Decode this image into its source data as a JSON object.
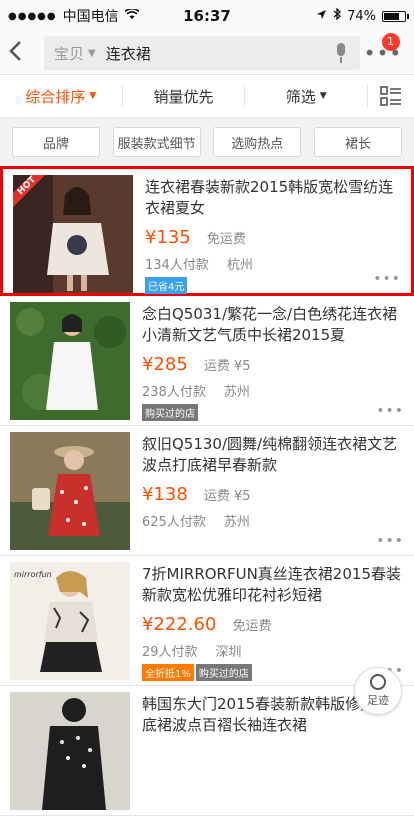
{
  "status": {
    "carrier": "中国电信",
    "time": "16:37",
    "battery": "74%",
    "battery_level": 0.74
  },
  "search": {
    "scope": "宝贝",
    "query": "连衣裙",
    "badge": "1"
  },
  "sort": {
    "items": [
      {
        "label": "综合排序",
        "active": true
      },
      {
        "label": "销量优先",
        "active": false
      },
      {
        "label": "筛选",
        "active": false
      }
    ]
  },
  "filters": [
    "品牌",
    "服装款式细节",
    "选购热点",
    "裙长"
  ],
  "products": [
    {
      "title": "连衣裙春装新款2015韩版宽松雪纺连衣裙夏女",
      "price": "¥135",
      "shipping": "免运费",
      "sold": "134人付款",
      "city": "杭州",
      "tags": [
        {
          "text": "已省4元",
          "color": "blue"
        }
      ],
      "hot": "HOT",
      "thumb_colors": [
        "#6a4a3a",
        "#e8e2d8",
        "#2c2020"
      ]
    },
    {
      "title": "念白Q5031/繁花一念/白色绣花连衣裙小清新文艺气质中长裙2015夏",
      "price": "¥285",
      "shipping": "运费 ¥5",
      "sold": "238人付款",
      "city": "苏州",
      "tags": [
        {
          "text": "购买过的店",
          "color": "gray"
        }
      ],
      "thumb_colors": [
        "#3e6b2e",
        "#f4f4f4",
        "#2f5a24"
      ]
    },
    {
      "title": "叙旧Q5130/圆舞/纯棉翻领连衣裙文艺波点打底裙早春新款",
      "price": "¥138",
      "shipping": "运费 ¥5",
      "sold": "625人付款",
      "city": "苏州",
      "tags": [],
      "thumb_colors": [
        "#8a7a5a",
        "#c9302c",
        "#4e5a3c"
      ]
    },
    {
      "title": "7折MIRRORFUN真丝连衣裙2015春装新款宽松优雅印花衬衫短裙",
      "price": "¥222.60",
      "shipping": "免运费",
      "sold": "29人付款",
      "city": "深圳",
      "tags": [
        {
          "text": "全折抵1%",
          "color": "orange"
        },
        {
          "text": "购买过的店",
          "color": "gray"
        }
      ],
      "brand": "mirrorfun",
      "thumb_colors": [
        "#f2eee8",
        "#e6e0d6",
        "#222222"
      ]
    },
    {
      "title": "韩国东大门2015春装新款韩版修身打底裙波点百褶长袖连衣裙",
      "price": "",
      "shipping": "",
      "sold": "",
      "city": "",
      "tags": [],
      "thumb_colors": [
        "#d8d4ce",
        "#1e1e1e",
        "#f0ede8"
      ]
    }
  ],
  "footer_button": "足迹",
  "colors": {
    "accent": "#ff5000",
    "highlight": "#e00000",
    "badge": "#ff3b30"
  }
}
